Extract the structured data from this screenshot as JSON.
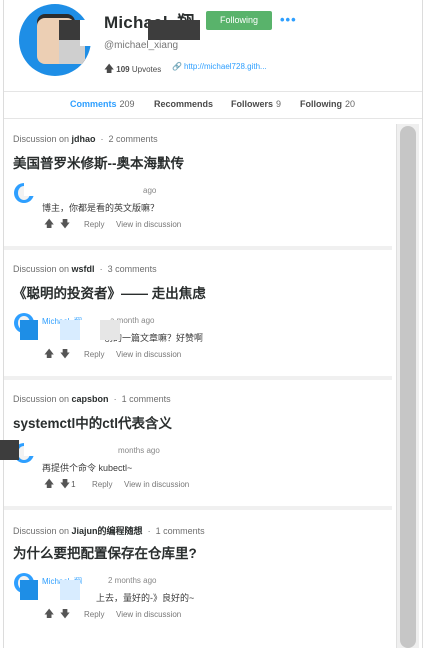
{
  "profile": {
    "username": "Michael_翔",
    "handle": "@michael_xiang",
    "follow_label": "Following",
    "more_label": "•••",
    "upvotes_count": "109",
    "upvotes_label": "Upvotes",
    "website": "http://michael728.gith..."
  },
  "tabs": [
    {
      "label": "Comments",
      "count": "209",
      "active": true
    },
    {
      "label": "Recommends",
      "count": ""
    },
    {
      "label": "Followers",
      "count": "9"
    },
    {
      "label": "Following",
      "count": "20"
    }
  ],
  "comments": [
    {
      "discussion_prefix": "Discussion on",
      "thread": "jdhao",
      "thread_comments": "2 comments",
      "title": "美国普罗米修斯--奥本海默传",
      "author": "",
      "time": "ago",
      "body": "博主，你都是看的英文版嘛？",
      "upvote_count": "",
      "reply": "Reply",
      "view": "View in discussion"
    },
    {
      "discussion_prefix": "Discussion on",
      "thread": "wsfdl",
      "thread_comments": "3 comments",
      "title": "《聪明的投资者》—— 走出焦虑",
      "author": "Michael_翔",
      "time": "a month ago",
      "body": "创的一篇文章嘛？好赞啊",
      "upvote_count": "",
      "reply": "Reply",
      "view": "View in discussion"
    },
    {
      "discussion_prefix": "Discussion on",
      "thread": "capsbon",
      "thread_comments": "1 comments",
      "title": "systemctl中的ctl代表含义",
      "author": "",
      "time": "months ago",
      "body": "再提供个命令 kubectl~",
      "upvote_count": "1",
      "reply": "Reply",
      "view": "View in discussion"
    },
    {
      "discussion_prefix": "Discussion on",
      "thread": "Jiajun的编程随想",
      "thread_comments": "1 comments",
      "title": "为什么要把配置保存在仓库里?",
      "author": "Michael_翔",
      "time": "2 months ago",
      "body": "上去，量好的-》良好的~",
      "upvote_count": "",
      "reply": "Reply",
      "view": "View in discussion"
    }
  ],
  "colors": {
    "accent": "#2e9fff",
    "follow_green": "#59b36b",
    "avatar_blue": "#1e8ee6"
  }
}
